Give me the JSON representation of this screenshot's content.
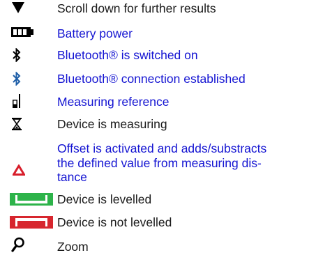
{
  "colors": {
    "text": "#1a1a1a",
    "link": "#1414d2",
    "green": "#2db34a",
    "red": "#d7262e",
    "offset_red": "#d81e2b",
    "bluetooth_blue": "#1f5fa8"
  },
  "items": [
    {
      "icon": "triangle-down-icon",
      "label": "Scroll down for further results",
      "is_link": false
    },
    {
      "icon": "battery-icon",
      "label": "Battery power",
      "is_link": true
    },
    {
      "icon": "bluetooth-icon",
      "label": "Bluetooth® is switched on",
      "is_link": true
    },
    {
      "icon": "bluetooth-connected-icon",
      "label": "Bluetooth® connection established",
      "is_link": true
    },
    {
      "icon": "measuring-reference-icon",
      "label": "Measuring reference",
      "is_link": true
    },
    {
      "icon": "hourglass-icon",
      "label": "Device is measuring",
      "is_link": false
    },
    {
      "icon": "offset-triangle-icon",
      "label_lines": [
        "Offset is activated and adds/substracts",
        "the defined value from measuring dis-",
        "tance"
      ],
      "is_link": true
    },
    {
      "icon": "level-ok-icon",
      "label": "Device is levelled",
      "is_link": false
    },
    {
      "icon": "level-not-ok-icon",
      "label": "Device is not levelled",
      "is_link": false
    },
    {
      "icon": "zoom-icon",
      "label": "Zoom",
      "is_link": false
    }
  ]
}
